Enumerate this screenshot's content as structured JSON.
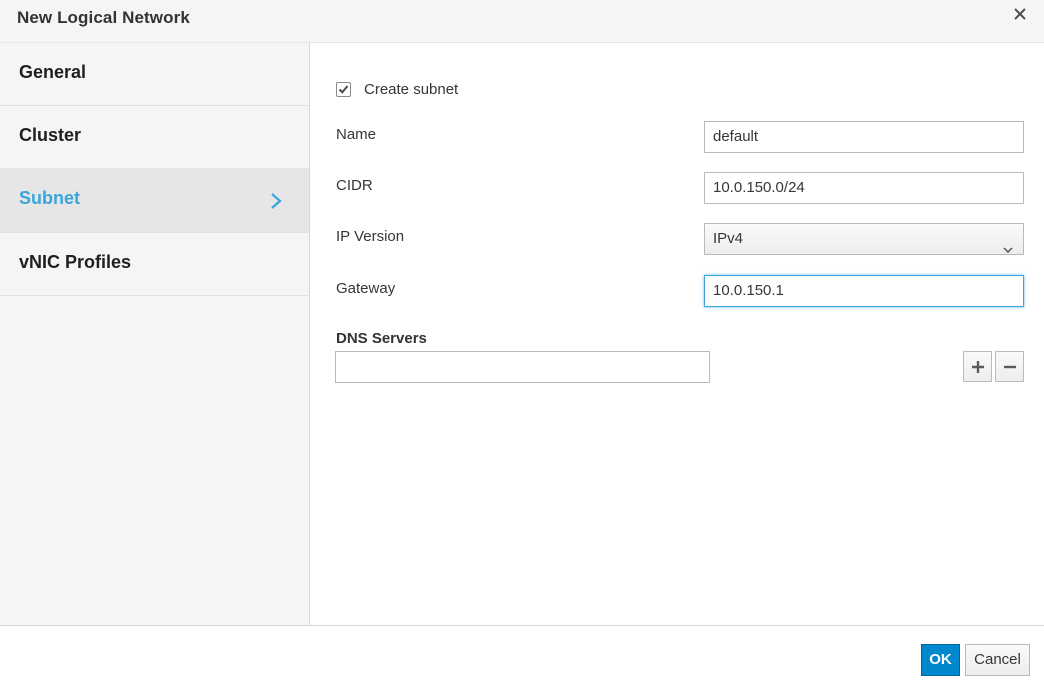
{
  "dialog": {
    "title": "New Logical Network",
    "close_icon": "close-icon"
  },
  "sidebar": {
    "items": [
      {
        "label": "General",
        "active": false
      },
      {
        "label": "Cluster",
        "active": false
      },
      {
        "label": "Subnet",
        "active": true
      },
      {
        "label": "vNIC Profiles",
        "active": false
      }
    ],
    "active_color": "#39a5dc"
  },
  "subnet": {
    "create_subnet": {
      "label": "Create subnet",
      "checked": true
    },
    "name": {
      "label": "Name",
      "value": "default"
    },
    "cidr": {
      "label": "CIDR",
      "value": "10.0.150.0/24"
    },
    "ip_version": {
      "label": "IP Version",
      "value": "IPv4"
    },
    "gateway": {
      "label": "Gateway",
      "value": "10.0.150.1"
    },
    "dns_servers": {
      "title": "DNS Servers",
      "value": ""
    }
  },
  "footer": {
    "ok_label": "OK",
    "cancel_label": "Cancel",
    "ok_color": "#0088ce"
  }
}
